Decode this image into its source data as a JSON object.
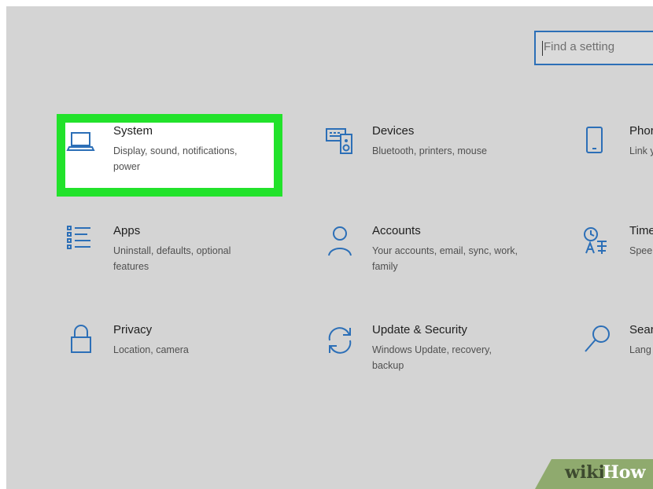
{
  "search": {
    "placeholder": "Find a setting"
  },
  "tiles": [
    {
      "title": "System",
      "description": "Display, sound, notifications, power",
      "icon": "laptop-icon",
      "highlighted": true
    },
    {
      "title": "Devices",
      "description": "Bluetooth, printers, mouse",
      "icon": "keyboard-speaker-icon"
    },
    {
      "title": "Phor",
      "description": "Link y",
      "icon": "phone-icon"
    },
    {
      "title": "Apps",
      "description": "Uninstall, defaults, optional features",
      "icon": "apps-list-icon"
    },
    {
      "title": "Accounts",
      "description": "Your accounts, email, sync, work, family",
      "icon": "person-icon"
    },
    {
      "title": "Time",
      "description": "Spee",
      "icon": "time-language-icon"
    },
    {
      "title": "Privacy",
      "description": "Location, camera",
      "icon": "lock-icon"
    },
    {
      "title": "Update & Security",
      "description": "Windows Update, recovery, backup",
      "icon": "sync-arrows-icon"
    },
    {
      "title": "Sear",
      "description": "Lang",
      "icon": "search-icon"
    }
  ],
  "colors": {
    "accent": "#2c6fb7",
    "highlight": "#22e22b",
    "background": "#d4d4d4"
  },
  "watermark": {
    "part1": "wiki",
    "part2": "How"
  }
}
